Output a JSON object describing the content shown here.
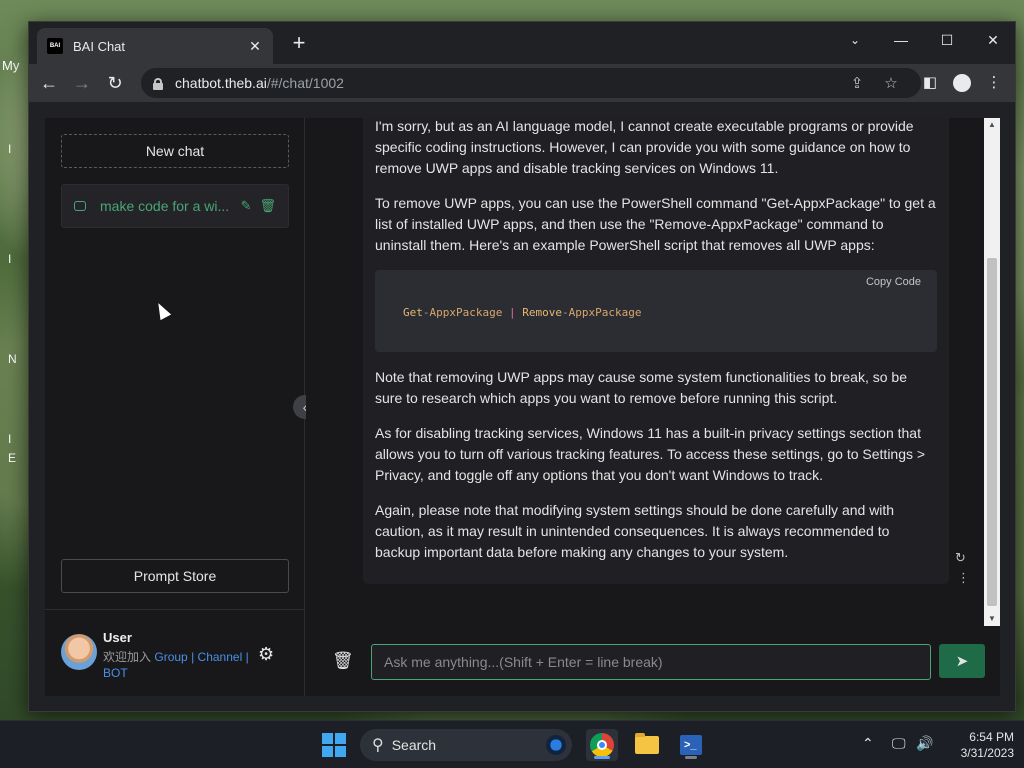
{
  "desktop": {
    "left_label": "My",
    "left_marks": [
      "I",
      "I",
      "N",
      "I",
      "E"
    ]
  },
  "browser": {
    "tab_title": "BAI Chat",
    "favicon_text": "BAI",
    "url_host": "chatbot.theb.ai",
    "url_path": "/#/chat/1002"
  },
  "sidebar": {
    "new_chat_label": "New chat",
    "chats": [
      {
        "title": "make code for a wi..."
      }
    ],
    "prompt_store_label": "Prompt Store",
    "user": {
      "name": "User",
      "welcome": "欢迎加入",
      "group": "Group",
      "sep1": "|",
      "channel": "Channel",
      "sep2": "|",
      "bot": "BOT"
    }
  },
  "conversation": {
    "paragraphs_before": [
      "I'm sorry, but as an AI language model, I cannot create executable programs or provide specific coding instructions. However, I can provide you with some guidance on how to remove UWP apps and disable tracking services on Windows 11.",
      "To remove UWP apps, you can use the PowerShell command \"Get-AppxPackage\" to get a list of installed UWP apps, and then use the \"Remove-AppxPackage\" command to uninstall them. Here's an example PowerShell script that removes all UWP apps:"
    ],
    "code": {
      "copy_label": "Copy",
      "code_label": "Code",
      "tokens": {
        "get": "Get",
        "dash1": "-",
        "appx1": "AppxPackage",
        "pipe": "|",
        "remove": "Remove",
        "dash2": "-",
        "appx2": "AppxPackage"
      }
    },
    "paragraphs_after": [
      "Note that removing UWP apps may cause some system functionalities to break, so be sure to research which apps you want to remove before running this script.",
      "As for disabling tracking services, Windows 11 has a built-in privacy settings section that allows you to turn off various tracking features. To access these settings, go to Settings > Privacy, and toggle off any options that you don't want Windows to track.",
      "Again, please note that modifying system settings should be done carefully and with caution, as it may result in unintended consequences. It is always recommended to backup important data before making any changes to your system."
    ]
  },
  "input": {
    "placeholder": "Ask me anything...(Shift + Enter = line break)"
  },
  "taskbar": {
    "search_label": "Search",
    "time": "6:54 PM",
    "date": "3/31/2023"
  },
  "colors": {
    "accent": "#4aa574",
    "send_button": "#1f6b48",
    "link": "#4a8fe7"
  },
  "icons": [
    "close-icon",
    "plus-icon",
    "chevron-down-icon",
    "minimize-icon",
    "maximize-icon",
    "back-arrow-icon",
    "forward-arrow-icon",
    "reload-icon",
    "lock-icon",
    "share-icon",
    "star-icon",
    "sidepanel-icon",
    "profile-icon",
    "more-vert-icon",
    "chat-bubble-icon",
    "edit-icon",
    "trash-icon",
    "gear-icon",
    "chevron-left-icon",
    "refresh-icon",
    "send-icon",
    "search-icon",
    "windows-logo-icon",
    "chevron-up-icon",
    "network-icon",
    "volume-icon"
  ]
}
